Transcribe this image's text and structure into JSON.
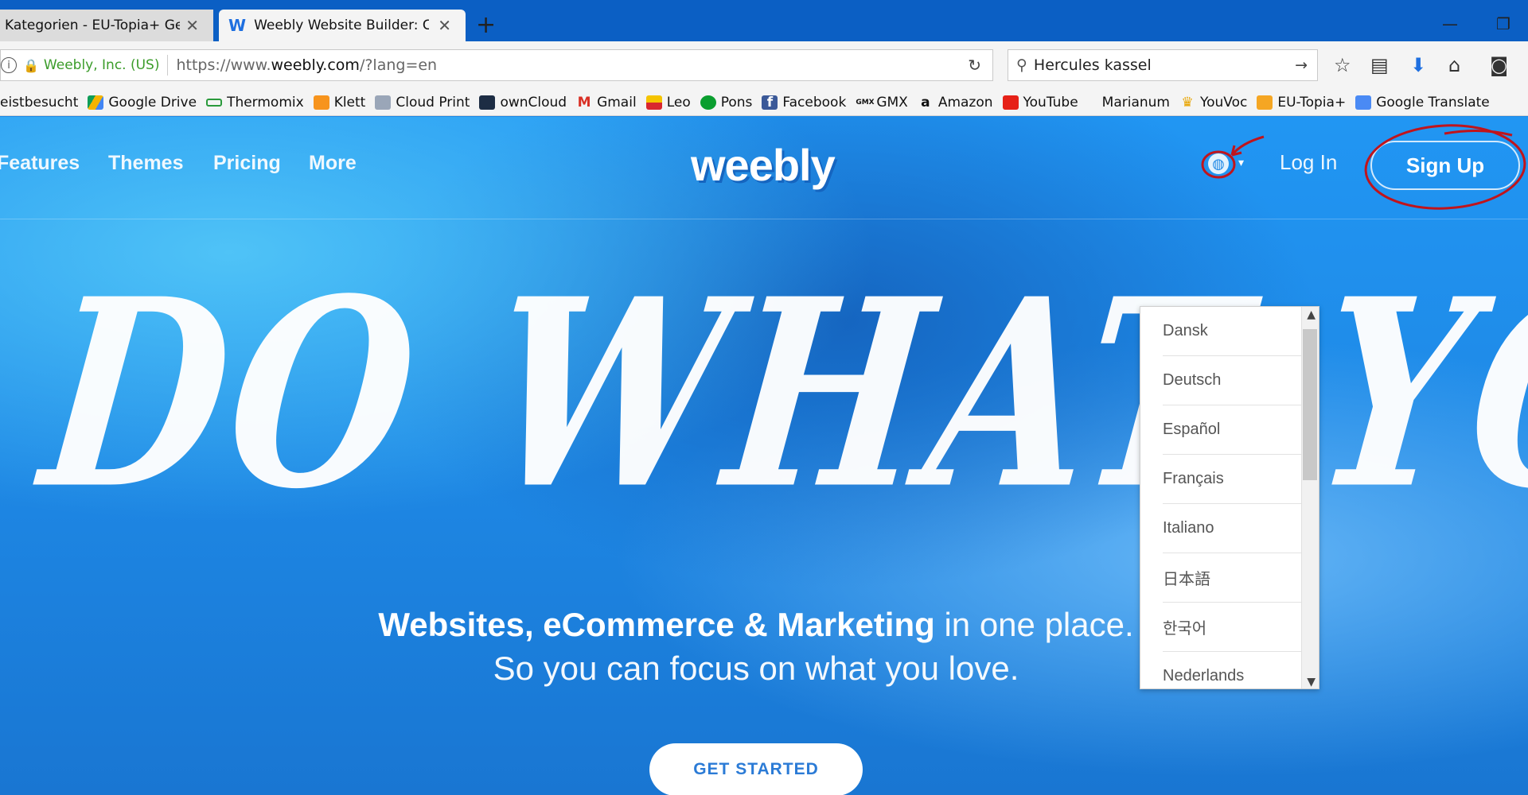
{
  "browser": {
    "tabs": [
      {
        "title": "Kategorien - EU-Topia+ Ger",
        "active": false
      },
      {
        "title": "Weebly Website Builder: Cre",
        "active": true
      }
    ],
    "new_tab": "+",
    "window_controls": {
      "minimize": "—",
      "restore": "❐"
    },
    "address": {
      "site_identity": "Weebly, Inc. (US)",
      "url_prefix": "https://www.",
      "url_domain": "weebly.com",
      "url_suffix": "/?lang=en"
    },
    "search": {
      "value": "Hercules kassel"
    },
    "bookmarks": [
      {
        "label": "eistbesucht",
        "icon": "none"
      },
      {
        "label": "Google Drive",
        "icon": "drive"
      },
      {
        "label": "Thermomix",
        "icon": "thermomix"
      },
      {
        "label": "Klett",
        "icon": "klett"
      },
      {
        "label": "Cloud Print",
        "icon": "cloudprint"
      },
      {
        "label": "ownCloud",
        "icon": "owncloud"
      },
      {
        "label": "Gmail",
        "icon": "gmail"
      },
      {
        "label": "Leo",
        "icon": "leo"
      },
      {
        "label": "Pons",
        "icon": "pons"
      },
      {
        "label": "Facebook",
        "icon": "facebook"
      },
      {
        "label": "GMX",
        "icon": "gmx"
      },
      {
        "label": "Amazon",
        "icon": "amazon"
      },
      {
        "label": "YouTube",
        "icon": "youtube"
      },
      {
        "label": "Marianum",
        "icon": "none"
      },
      {
        "label": "YouVoc",
        "icon": "youvoc"
      },
      {
        "label": "EU-Topia+",
        "icon": "rss"
      },
      {
        "label": "Google Translate",
        "icon": "translate"
      }
    ]
  },
  "site": {
    "nav": {
      "features": "Features",
      "themes": "Themes",
      "pricing": "Pricing",
      "more": "More"
    },
    "logo": "weebly",
    "login": "Log In",
    "signup": "Sign Up",
    "hero_title": "DO WHAT YOU LOVE",
    "tagline_bold": "Websites, eCommerce & Marketing",
    "tagline_rest": " in one place.",
    "tagline_line2": "So you can focus on what you love.",
    "cta": "GET STARTED"
  },
  "language_menu": {
    "items": [
      "Dansk",
      "Deutsch",
      "Español",
      "Français",
      "Italiano",
      "日本語",
      "한국어",
      "Nederlands"
    ]
  },
  "colors": {
    "brand_blue": "#1e88e5",
    "annotation_red": "#c0141c",
    "cta_text": "#2b7bd6"
  }
}
